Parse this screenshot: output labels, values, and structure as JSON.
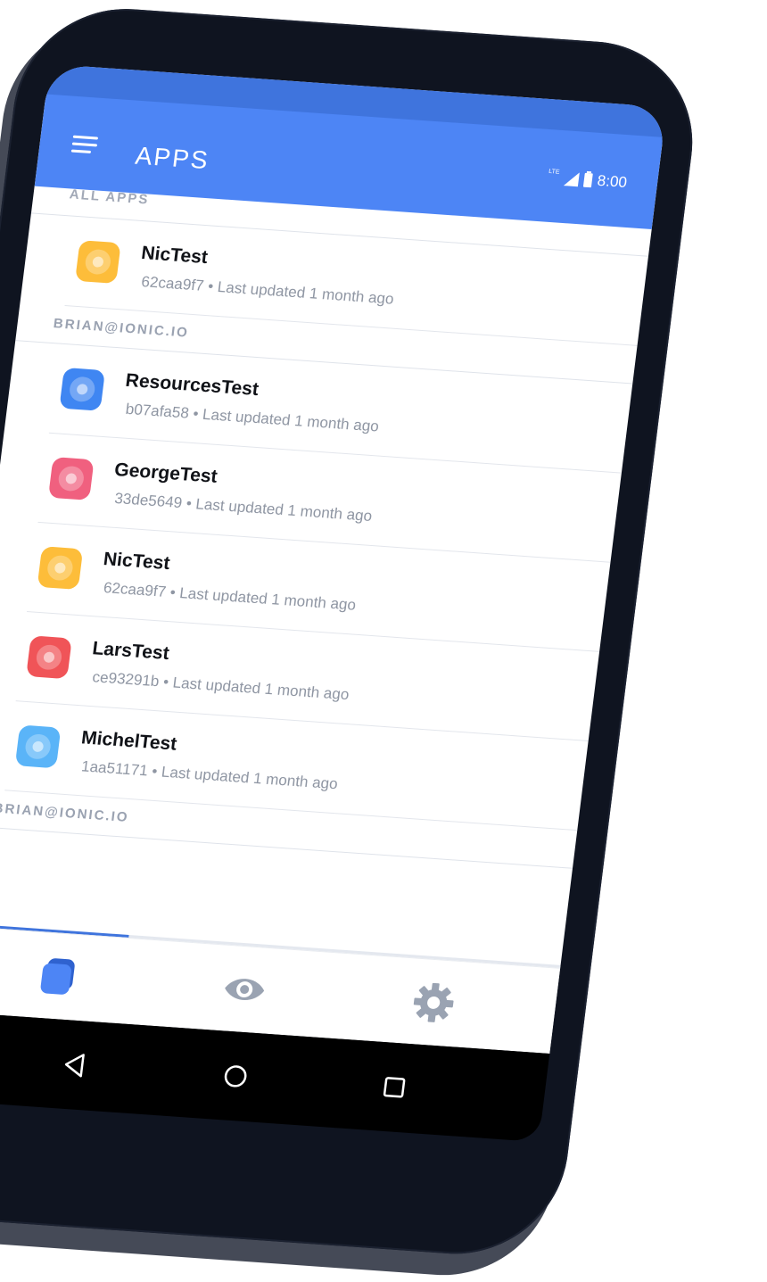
{
  "appbar": {
    "title": "APPS",
    "status": {
      "network": "LTE",
      "time": "8:00"
    }
  },
  "sections": [
    {
      "header": "ALL APPS",
      "items": [
        {
          "name": "NicTest",
          "meta": "62caa9f7 • Last updated 1 month ago",
          "color": "#fdbd3a"
        }
      ]
    },
    {
      "header": "BRIAN@IONIC.IO",
      "items": [
        {
          "name": "ResourcesTest",
          "meta": "b07afa58 • Last updated 1 month ago",
          "color": "#3f86f2"
        },
        {
          "name": "GeorgeTest",
          "meta": "33de5649 • Last updated 1 month ago",
          "color": "#f0607f"
        },
        {
          "name": "NicTest",
          "meta": "62caa9f7 • Last updated 1 month ago",
          "color": "#fdbd3a"
        },
        {
          "name": "LarsTest",
          "meta": "ce93291b • Last updated 1 month ago",
          "color": "#f05458"
        },
        {
          "name": "MichelTest",
          "meta": "1aa51171 • Last updated 1 month ago",
          "color": "#5ab4f8"
        }
      ]
    },
    {
      "header": "BRIAN@IONIC.IO",
      "items": []
    }
  ],
  "tabs": [
    {
      "icon": "apps-icon",
      "active": true
    },
    {
      "icon": "eye-icon",
      "active": false
    },
    {
      "icon": "gear-icon",
      "active": false
    }
  ],
  "colors": {
    "primary": "#4d85f5",
    "primary_dark": "#3f74dd",
    "inactive_icon": "#9aa3b2"
  },
  "scroll_progress": 0.3
}
